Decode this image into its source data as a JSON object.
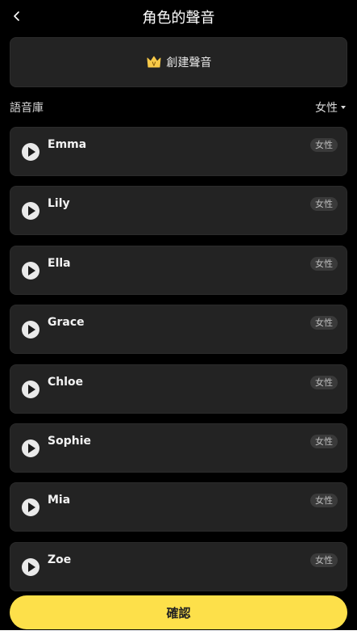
{
  "header": {
    "back_icon": "chevron-left-icon",
    "title": "角色的聲音"
  },
  "create": {
    "icon": "crown-icon",
    "label": "創建聲音",
    "accent": "#f7c948"
  },
  "library": {
    "label": "語音庫",
    "filter_value": "女性"
  },
  "voices": [
    {
      "name": "Emma",
      "tag": "女性"
    },
    {
      "name": "Lily",
      "tag": "女性"
    },
    {
      "name": "Ella",
      "tag": "女性"
    },
    {
      "name": "Grace",
      "tag": "女性"
    },
    {
      "name": "Chloe",
      "tag": "女性"
    },
    {
      "name": "Sophie",
      "tag": "女性"
    },
    {
      "name": "Mia",
      "tag": "女性"
    },
    {
      "name": "Zoe",
      "tag": "女性"
    }
  ],
  "confirm": {
    "label": "確認",
    "color": "#fde04a"
  }
}
